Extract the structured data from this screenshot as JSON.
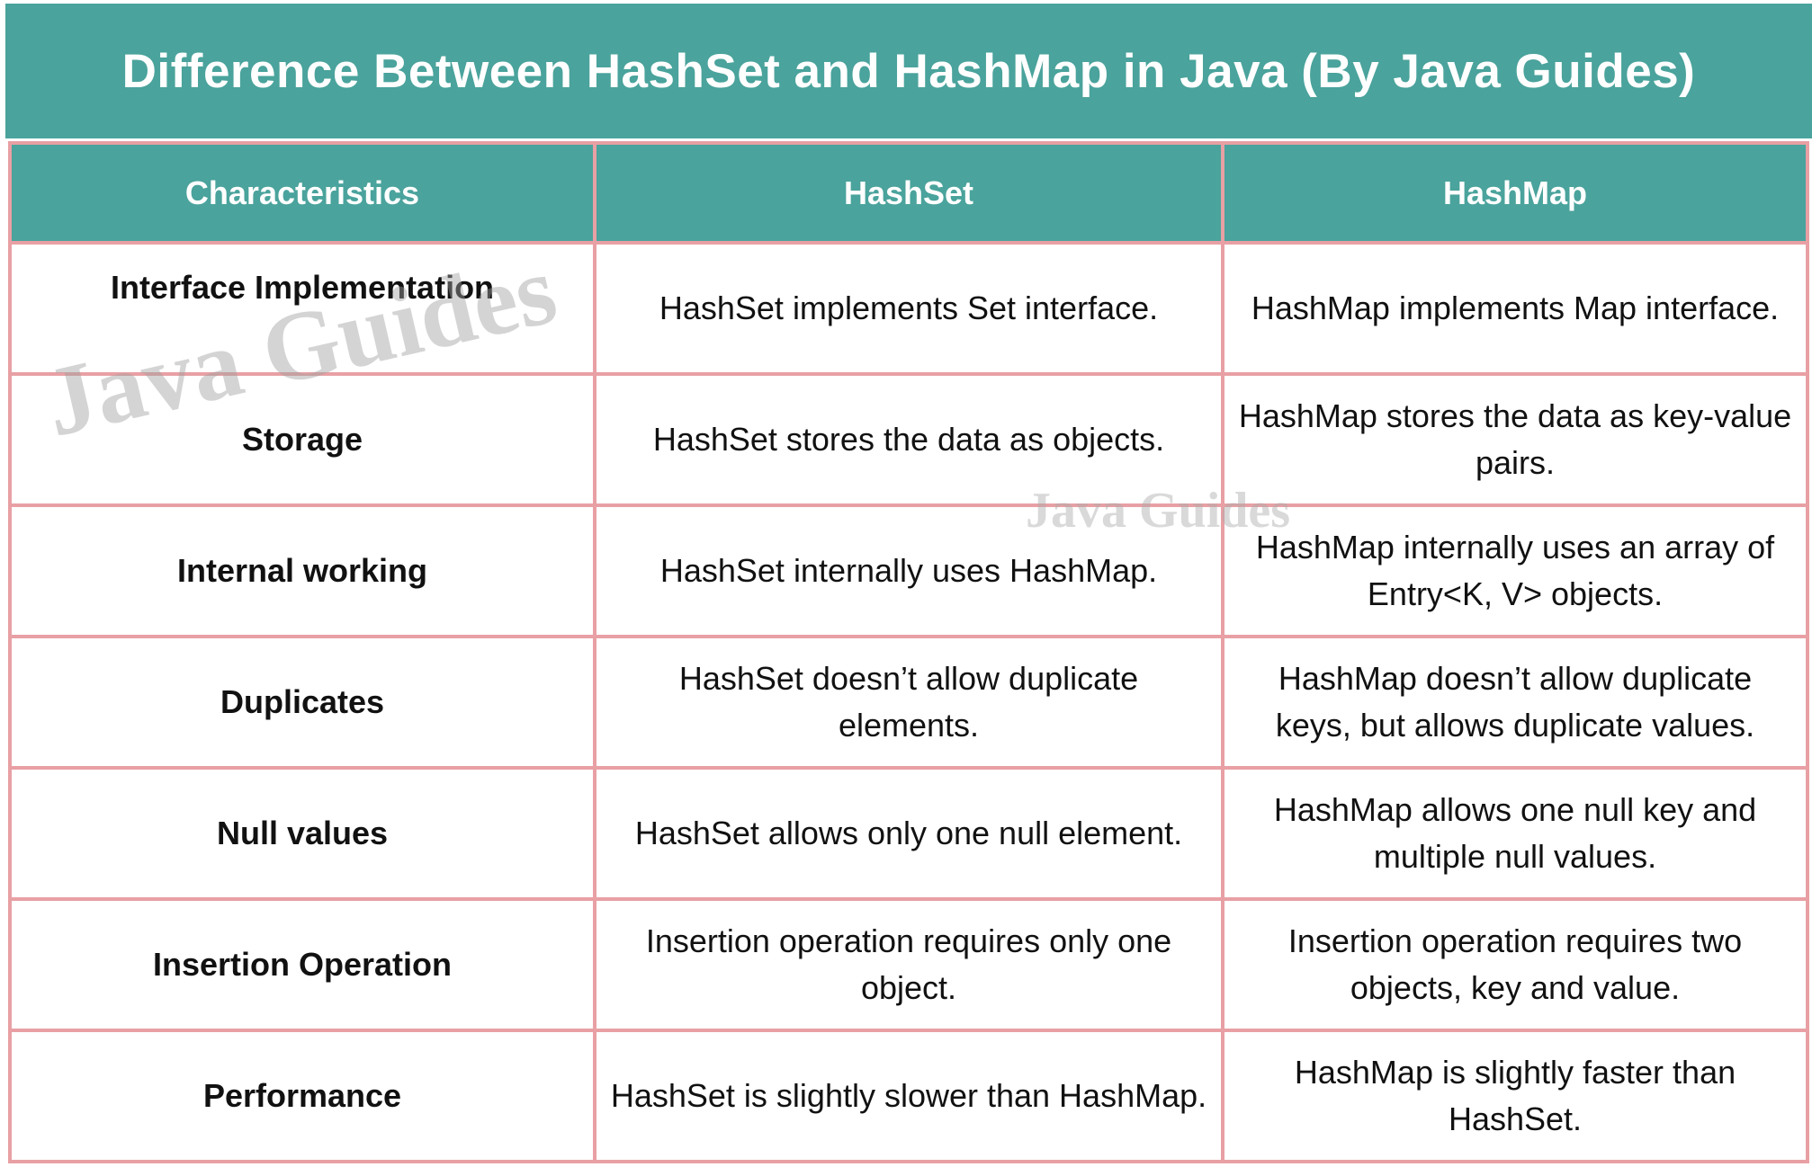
{
  "title": "Difference Between HashSet and HashMap in Java (By Java Guides)",
  "colors": {
    "header_bg": "#4aa39c",
    "border": "#e8a0a4",
    "header_text": "#ffffff",
    "body_text": "#111111"
  },
  "table": {
    "headers": [
      "Characteristics",
      "HashSet",
      "HashMap"
    ],
    "rows": [
      {
        "characteristic": "Interface Implementation",
        "hashset": "HashSet implements Set interface.",
        "hashmap": "HashMap implements Map interface."
      },
      {
        "characteristic": "Storage",
        "hashset": "HashSet stores the data as objects.",
        "hashmap": "HashMap stores the data as key-value pairs."
      },
      {
        "characteristic": "Internal working",
        "hashset": "HashSet internally uses HashMap.",
        "hashmap": "HashMap internally uses an array of Entry<K, V> objects."
      },
      {
        "characteristic": "Duplicates",
        "hashset": "HashSet doesn’t allow duplicate elements.",
        "hashmap": "HashMap doesn’t allow duplicate keys, but allows duplicate values."
      },
      {
        "characteristic": "Null values",
        "hashset": "HashSet allows only one null element.",
        "hashmap": "HashMap allows one null key and multiple null values."
      },
      {
        "characteristic": "Insertion Operation",
        "hashset": "Insertion operation requires only one object.",
        "hashmap": "Insertion operation requires two objects, key and value."
      },
      {
        "characteristic": "Performance",
        "hashset": "HashSet is slightly slower than HashMap.",
        "hashmap": "HashMap is slightly faster than HashSet."
      }
    ]
  },
  "watermarks": {
    "large": "Java Guides",
    "small": "Java Guides"
  }
}
